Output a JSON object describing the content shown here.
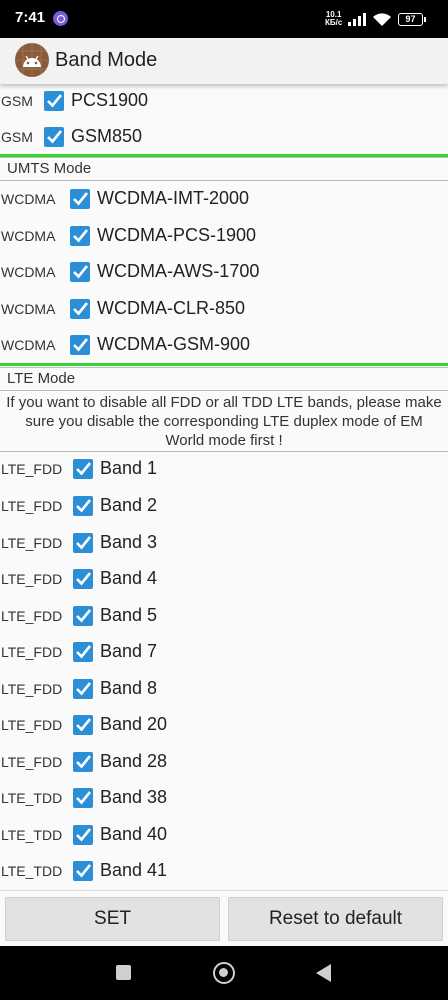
{
  "status_bar": {
    "time": "7:41",
    "net_speed_top": "10.1",
    "net_speed_bottom": "КБ/с",
    "battery": "97"
  },
  "app_bar": {
    "title": "Band Mode",
    "icon": "android-icon"
  },
  "gsm": [
    {
      "type": "GSM",
      "band": "PCS1900",
      "checked": true
    },
    {
      "type": "GSM",
      "band": "GSM850",
      "checked": true
    }
  ],
  "umts": {
    "header": "UMTS Mode",
    "items": [
      {
        "type": "WCDMA",
        "band": "WCDMA-IMT-2000",
        "checked": true
      },
      {
        "type": "WCDMA",
        "band": "WCDMA-PCS-1900",
        "checked": true
      },
      {
        "type": "WCDMA",
        "band": "WCDMA-AWS-1700",
        "checked": true
      },
      {
        "type": "WCDMA",
        "band": "WCDMA-CLR-850",
        "checked": true
      },
      {
        "type": "WCDMA",
        "band": "WCDMA-GSM-900",
        "checked": true
      }
    ]
  },
  "lte": {
    "header": "LTE Mode",
    "note": "If you want to disable all FDD or all TDD LTE bands, please make sure you disable the corresponding LTE duplex mode of EM World mode first !",
    "items": [
      {
        "type": "LTE_FDD",
        "band": "Band 1",
        "checked": true
      },
      {
        "type": "LTE_FDD",
        "band": "Band 2",
        "checked": true
      },
      {
        "type": "LTE_FDD",
        "band": "Band 3",
        "checked": true
      },
      {
        "type": "LTE_FDD",
        "band": "Band 4",
        "checked": true
      },
      {
        "type": "LTE_FDD",
        "band": "Band 5",
        "checked": true
      },
      {
        "type": "LTE_FDD",
        "band": "Band 7",
        "checked": true
      },
      {
        "type": "LTE_FDD",
        "band": "Band 8",
        "checked": true
      },
      {
        "type": "LTE_FDD",
        "band": "Band 20",
        "checked": true
      },
      {
        "type": "LTE_FDD",
        "band": "Band 28",
        "checked": true
      },
      {
        "type": "LTE_TDD",
        "band": "Band 38",
        "checked": true
      },
      {
        "type": "LTE_TDD",
        "band": "Band 40",
        "checked": true
      },
      {
        "type": "LTE_TDD",
        "band": "Band 41",
        "checked": true
      }
    ]
  },
  "buttons": {
    "set": "SET",
    "reset": "Reset to default"
  },
  "colors": {
    "checkbox": "#2a8fd6",
    "divider_green": "#2ed82e",
    "app_icon_bg": "#8a5a3c"
  }
}
